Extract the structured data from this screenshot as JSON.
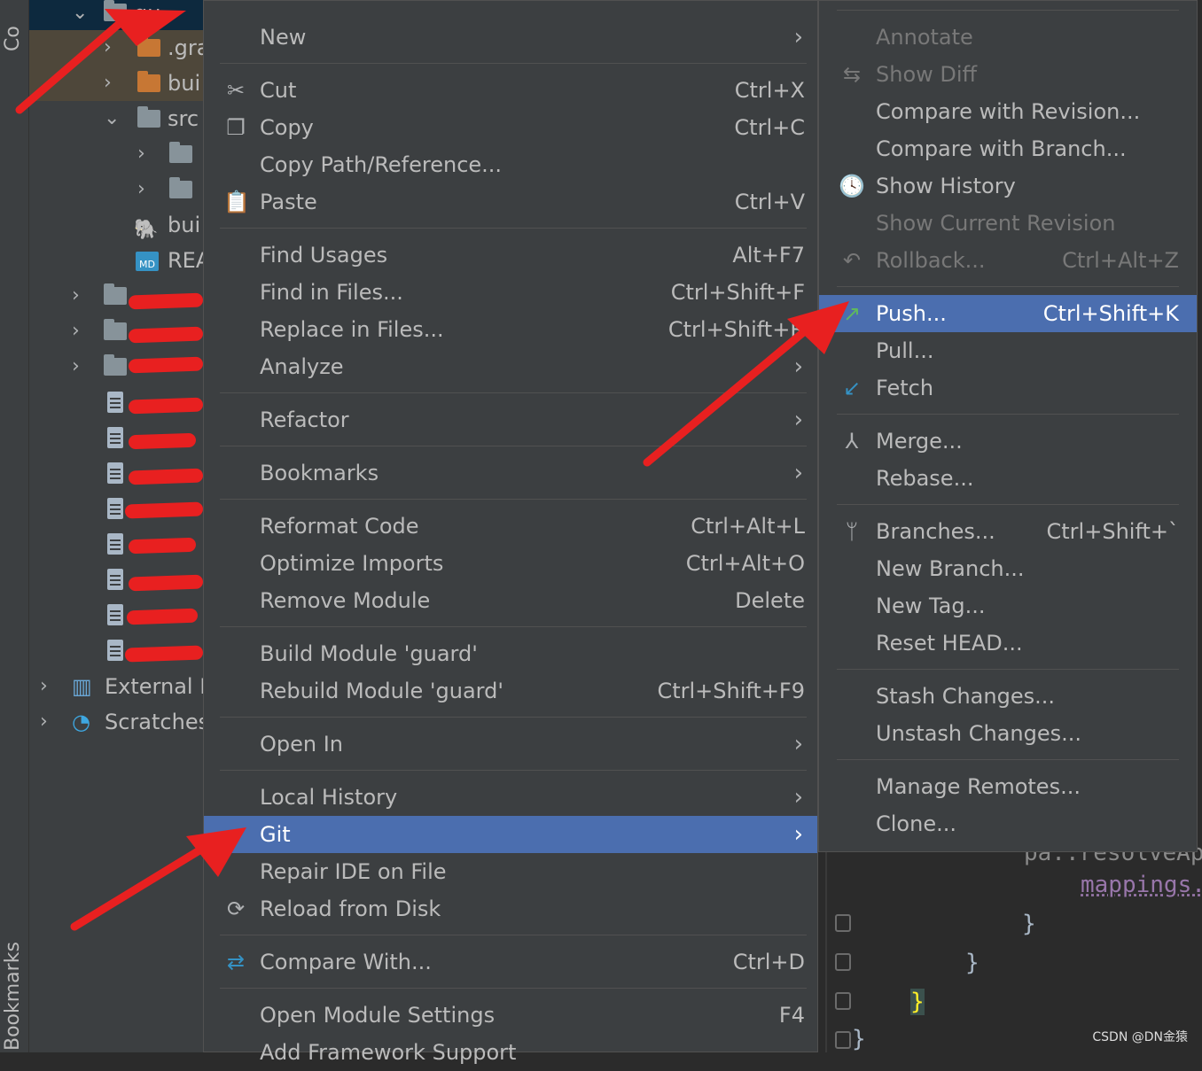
{
  "left_stripe": {
    "top_label": "Co",
    "bottom_label": "Bookmarks"
  },
  "tree": {
    "rows": [
      {
        "label": "gu"
      },
      {
        "label": ".gra"
      },
      {
        "label": "bui"
      },
      {
        "label": "src"
      },
      {
        "label": ""
      },
      {
        "label": ""
      },
      {
        "label": "bui"
      },
      {
        "label": "REA"
      },
      {
        "label": "External L"
      },
      {
        "label": "Scratches"
      }
    ]
  },
  "menu": {
    "items": [
      {
        "label": "New",
        "shortcut": "",
        "submenu": true,
        "icon": ""
      },
      {
        "label": "Cut",
        "shortcut": "Ctrl+X",
        "icon": "cut-icon"
      },
      {
        "label": "Copy",
        "shortcut": "Ctrl+C",
        "icon": "copy-icon"
      },
      {
        "label": "Copy Path/Reference...",
        "shortcut": ""
      },
      {
        "label": "Paste",
        "shortcut": "Ctrl+V",
        "icon": "paste-icon"
      },
      {
        "label": "Find Usages",
        "shortcut": "Alt+F7"
      },
      {
        "label": "Find in Files...",
        "shortcut": "Ctrl+Shift+F"
      },
      {
        "label": "Replace in Files...",
        "shortcut": "Ctrl+Shift+R"
      },
      {
        "label": "Analyze",
        "shortcut": "",
        "submenu": true
      },
      {
        "label": "Refactor",
        "shortcut": "",
        "submenu": true
      },
      {
        "label": "Bookmarks",
        "shortcut": "",
        "submenu": true
      },
      {
        "label": "Reformat Code",
        "shortcut": "Ctrl+Alt+L"
      },
      {
        "label": "Optimize Imports",
        "shortcut": "Ctrl+Alt+O"
      },
      {
        "label": "Remove Module",
        "shortcut": "Delete"
      },
      {
        "label": "Build Module 'guard'",
        "shortcut": ""
      },
      {
        "label": "Rebuild Module 'guard'",
        "shortcut": "Ctrl+Shift+F9"
      },
      {
        "label": "Open In",
        "shortcut": "",
        "submenu": true
      },
      {
        "label": "Local History",
        "shortcut": "",
        "submenu": true
      },
      {
        "label": "Git",
        "shortcut": "",
        "submenu": true,
        "selected": true
      },
      {
        "label": "Repair IDE on File",
        "shortcut": ""
      },
      {
        "label": "Reload from Disk",
        "shortcut": "",
        "icon": "reload-icon"
      },
      {
        "label": "Compare With...",
        "shortcut": "Ctrl+D",
        "icon": "compare-icon"
      },
      {
        "label": "Open Module Settings",
        "shortcut": "F4"
      },
      {
        "label": "Add Framework Support",
        "shortcut": ""
      }
    ]
  },
  "git_submenu": {
    "items": [
      {
        "label": "Annotate",
        "shortcut": "",
        "disabled": true
      },
      {
        "label": "Show Diff",
        "shortcut": "",
        "disabled": true,
        "icon": "diff-icon"
      },
      {
        "label": "Compare with Revision...",
        "shortcut": ""
      },
      {
        "label": "Compare with Branch...",
        "shortcut": ""
      },
      {
        "label": "Show History",
        "shortcut": "",
        "icon": "history-icon"
      },
      {
        "label": "Show Current Revision",
        "shortcut": "",
        "disabled": true
      },
      {
        "label": "Rollback...",
        "shortcut": "Ctrl+Alt+Z",
        "disabled": true,
        "icon": "rollback-icon"
      },
      {
        "label": "Push...",
        "shortcut": "Ctrl+Shift+K",
        "selected": true,
        "icon": "push-icon"
      },
      {
        "label": "Pull...",
        "shortcut": ""
      },
      {
        "label": "Fetch",
        "shortcut": "",
        "icon": "fetch-icon"
      },
      {
        "label": "Merge...",
        "shortcut": "",
        "icon": "merge-icon"
      },
      {
        "label": "Rebase...",
        "shortcut": ""
      },
      {
        "label": "Branches...",
        "shortcut": "Ctrl+Shift+`",
        "icon": "branch-icon"
      },
      {
        "label": "New Branch...",
        "shortcut": ""
      },
      {
        "label": "New Tag...",
        "shortcut": ""
      },
      {
        "label": "Reset HEAD...",
        "shortcut": ""
      },
      {
        "label": "Stash Changes...",
        "shortcut": ""
      },
      {
        "label": "Unstash Changes...",
        "shortcut": ""
      },
      {
        "label": "Manage Remotes...",
        "shortcut": ""
      },
      {
        "label": "Clone...",
        "shortcut": ""
      }
    ]
  },
  "editor": {
    "lines": [
      "pa..resolveApp",
      "mappings.",
      "}",
      "}",
      "}",
      "}"
    ]
  },
  "watermark": "CSDN @DN金猿",
  "colors": {
    "selection": "#4b6eaf",
    "menu_bg": "#3c3f41",
    "editor_bg": "#2b2b2b",
    "annotation_red": "#e82020"
  }
}
